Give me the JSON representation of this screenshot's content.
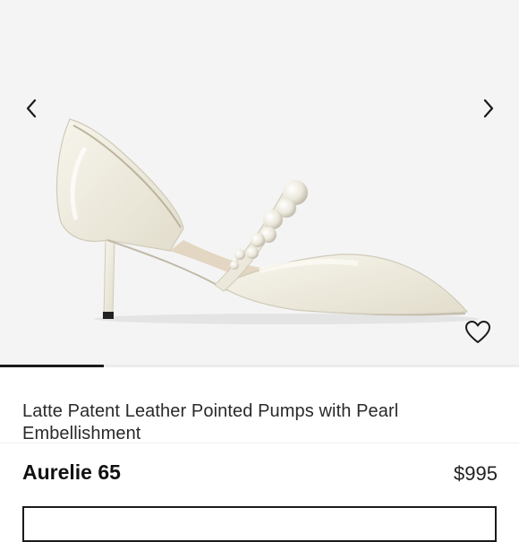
{
  "product": {
    "description": "Latte Patent Leather Pointed Pumps with Pearl Embellishment",
    "name": "Aurelie 65",
    "price": "$995",
    "image_icon": "shoe-photo"
  },
  "gallery": {
    "prev_icon": "chevron-left-icon",
    "next_icon": "chevron-right-icon",
    "favorite_icon": "heart-icon",
    "progress_fraction": 0.2
  },
  "colors": {
    "gallery_bg": "#f4f4f4",
    "text": "#1a1a1a",
    "shoe": "#ece9dc"
  }
}
